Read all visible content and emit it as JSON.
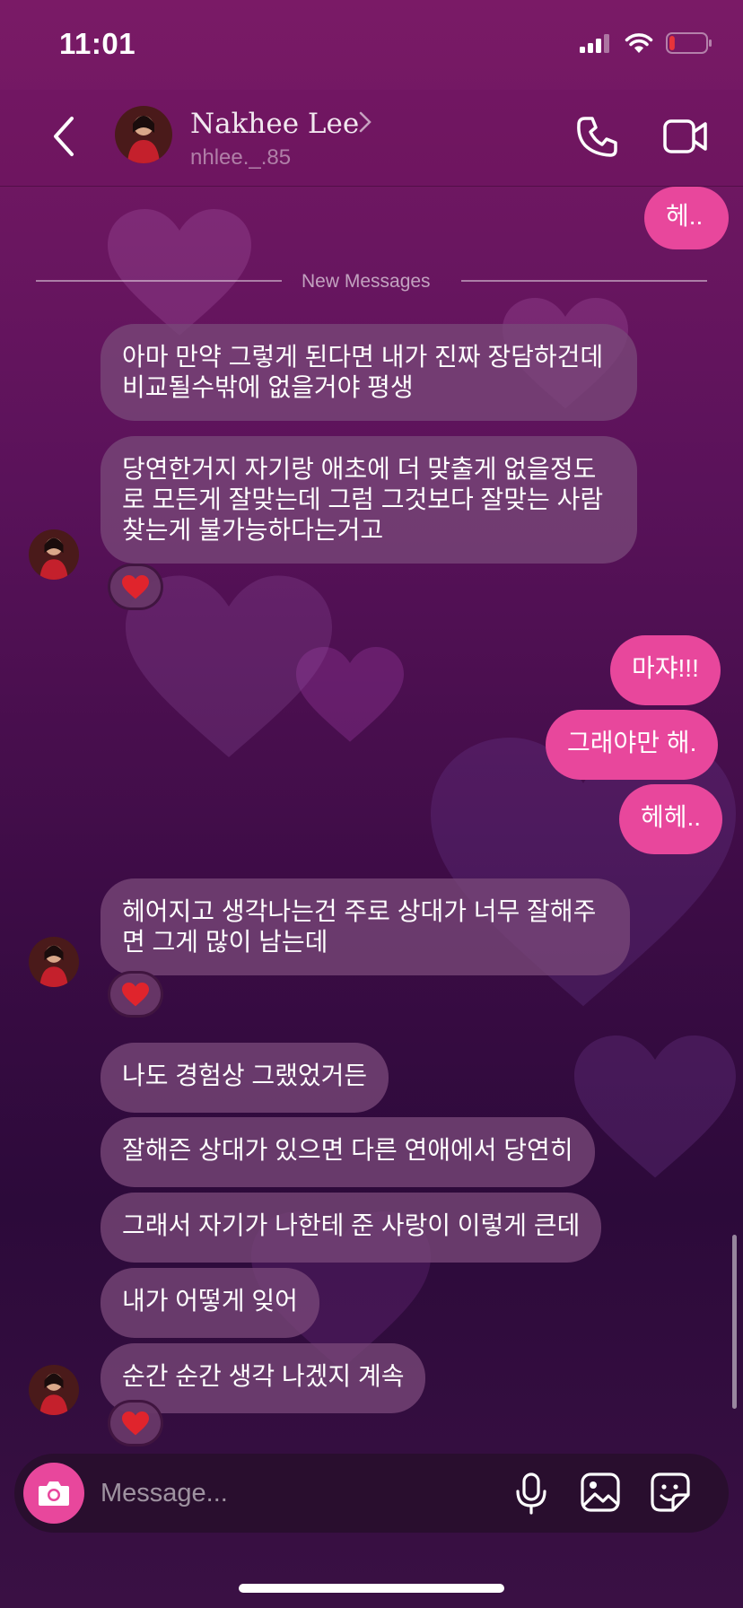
{
  "status_bar": {
    "time": "11:01",
    "battery_level": 0.15
  },
  "header": {
    "contact_name": "Nakhee Lee",
    "contact_handle": "nhlee._.85"
  },
  "divider": {
    "label": "New Messages"
  },
  "messages": [
    {
      "sender": "me",
      "text": "헤.."
    },
    {
      "sender": "them",
      "text": "아마 만약 그렇게 된다면 내가 진짜 장담하건데 비교될수밖에 없을거야 평생"
    },
    {
      "sender": "them",
      "text": "당연한거지 자기랑 애초에 더 맞출게 없을정도로 모든게 잘맞는데 그럼 그것보다 잘맞는 사람 찾는게 불가능하다는거고",
      "reaction": "heart"
    },
    {
      "sender": "me",
      "text": "마쟈!!!"
    },
    {
      "sender": "me",
      "text": "그래야만 해."
    },
    {
      "sender": "me",
      "text": "헤헤.."
    },
    {
      "sender": "them",
      "text": "헤어지고 생각나는건 주로 상대가 너무 잘해주면 그게 많이 남는데",
      "reaction": "heart"
    },
    {
      "sender": "them",
      "text": "나도 경험상 그랬었거든"
    },
    {
      "sender": "them",
      "text": "잘해즌 상대가 있으면 다른 연애에서 당연히"
    },
    {
      "sender": "them",
      "text": "그래서 자기가 나한테 준 사랑이 이렇게 큰데"
    },
    {
      "sender": "them",
      "text": "내가 어떻게 잊어"
    },
    {
      "sender": "them",
      "text": "순간 순간 생각 나겠지 계속",
      "reaction": "heart"
    }
  ],
  "composer": {
    "placeholder": "Message..."
  },
  "colors": {
    "outgoing": "#e8479c",
    "incoming": "#784878",
    "reaction_heart": "#e0242c"
  },
  "icons": [
    "back-chevron-icon",
    "phone-icon",
    "video-camera-icon",
    "camera-icon",
    "microphone-icon",
    "gallery-icon",
    "sticker-icon",
    "heart-icon"
  ]
}
